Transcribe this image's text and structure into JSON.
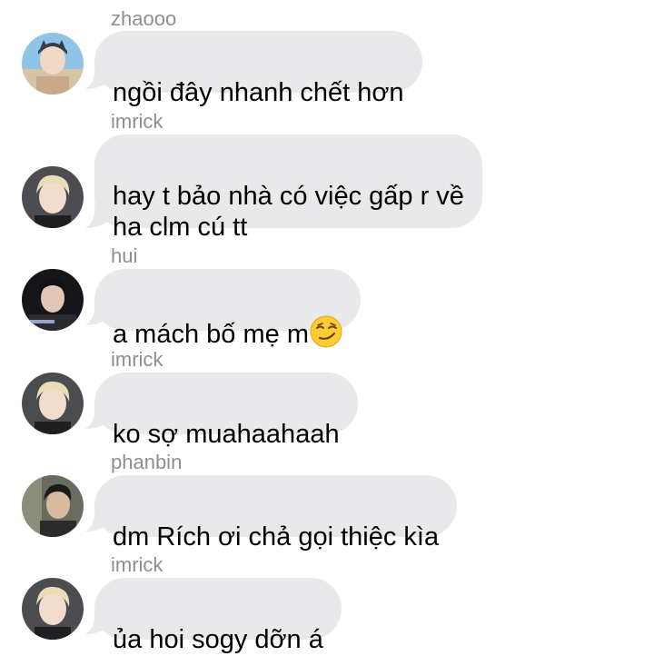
{
  "messages": [
    {
      "sender": "zhaooo",
      "text": "ngồi đây nhanh chết hơn",
      "avatar": "avatar-zhaooo"
    },
    {
      "sender": "imrick",
      "text": "hay t bảo nhà có việc gấp r về\nha clm cú tt",
      "avatar": "avatar-imrick"
    },
    {
      "sender": "hui",
      "text": "a mách bố mẹ m",
      "emoji": "smirking-face-emoji",
      "avatar": "avatar-hui"
    },
    {
      "sender": "imrick",
      "text": "ko sợ muahaahaah",
      "avatar": "avatar-imrick"
    },
    {
      "sender": "phanbin",
      "text": "dm Rích ơi chả gọi thiệc kìa",
      "avatar": "avatar-phanbin"
    },
    {
      "sender": "imrick",
      "text": "ủa hoi sogy dỡn á",
      "avatar": "avatar-imrick"
    }
  ],
  "colors": {
    "bubble": "#e9e9eb",
    "sender_name": "#8e8e93",
    "text": "#000000",
    "background": "#ffffff"
  }
}
